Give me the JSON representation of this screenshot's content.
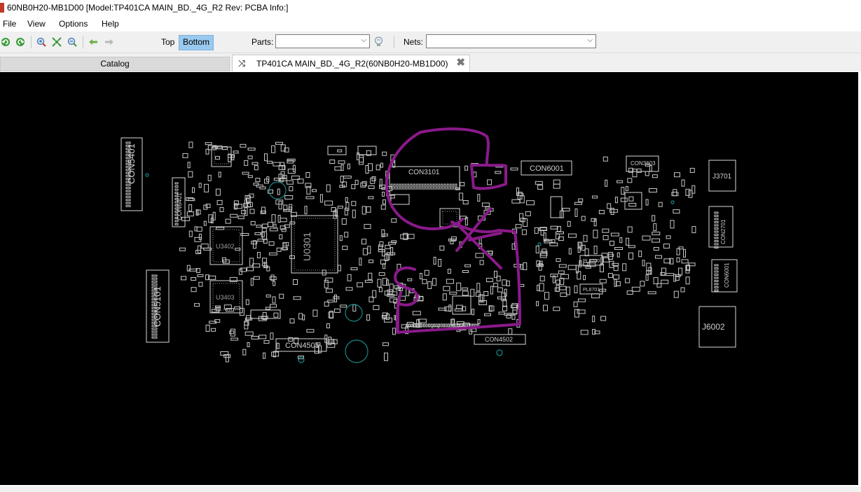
{
  "window": {
    "title": "60NB0H20-MB1D00 [Model:TP401CA MAIN_BD._4G_R2 Rev: PCBA Info:]"
  },
  "menu": {
    "items": [
      {
        "label": "File"
      },
      {
        "label": "View"
      },
      {
        "label": "Options"
      },
      {
        "label": "Help"
      }
    ]
  },
  "toolbar": {
    "icons": [
      "rotate-left-icon",
      "rotate-right-icon",
      "zoom-in-icon",
      "zoom-fit-icon",
      "zoom-out-icon",
      "back-arrow-icon",
      "forward-arrow-icon"
    ],
    "top_label": "Top",
    "bottom_label": "Bottom",
    "active_layer": "Bottom",
    "parts_label": "Parts:",
    "parts_value": "",
    "nets_label": "Nets:",
    "nets_value": "",
    "accent_color": "#99c9ef"
  },
  "tabs": {
    "catalog_label": "Catalog",
    "document_label": "TP401CA MAIN_BD._4G_R2(60NB0H20-MB1D00)"
  },
  "board": {
    "background_color": "#000000",
    "outline_color": "#d8d8d8",
    "annotation_color": "#8a1a8a",
    "via_color": "#1a8a8a",
    "labels": {
      "con5401": "CON5401",
      "con6401": "CON6401",
      "con3101": "CON3101",
      "con6001": "CON6001",
      "con3603": "CON3603",
      "j3701": "J3701",
      "con5101": "CON5101",
      "con4501": "CON4501",
      "con4502": "CON4502",
      "j6002": "J6002",
      "u0301": "U0301",
      "u3402": "U3402",
      "u3403": "U3403",
      "con2701": "CON2701",
      "con6001b": "CON6001",
      "pl8700": "PL8700",
      "pl8701": "PL8701"
    }
  }
}
